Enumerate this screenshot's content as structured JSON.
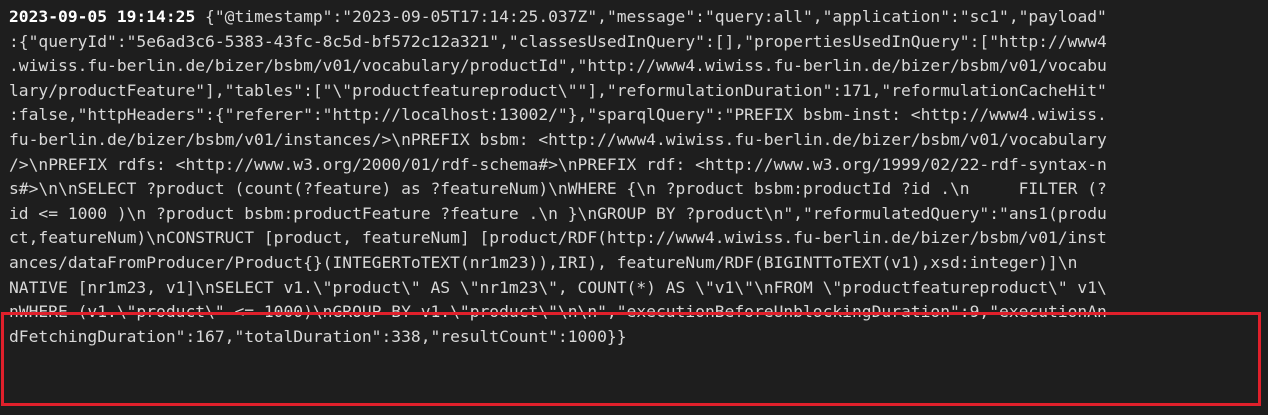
{
  "terminal": {
    "timestamp": "2023-09-05 19:14:25",
    "first_line_rest": " {\"@timestamp\":\"2023-09-05T17:14:25.037Z\",\"message\":\"query:all\",\"application\":\"sc1\",\"payload\"",
    "lines": [
      ":{\"queryId\":\"5e6ad3c6-5383-43fc-8c5d-bf572c12a321\",\"classesUsedInQuery\":[],\"propertiesUsedInQuery\":[\"http://www4",
      ".wiwiss.fu-berlin.de/bizer/bsbm/v01/vocabulary/productId\",\"http://www4.wiwiss.fu-berlin.de/bizer/bsbm/v01/vocabu",
      "lary/productFeature\"],\"tables\":[\"\\\"productfeatureproduct\\\"\"],\"reformulationDuration\":171,\"reformulationCacheHit\"",
      ":false,\"httpHeaders\":{\"referer\":\"http://localhost:13002/\"},\"sparqlQuery\":\"PREFIX bsbm-inst: <http://www4.wiwiss.",
      "fu-berlin.de/bizer/bsbm/v01/instances/>\\nPREFIX bsbm: <http://www4.wiwiss.fu-berlin.de/bizer/bsbm/v01/vocabulary",
      "/>\\nPREFIX rdfs: <http://www.w3.org/2000/01/rdf-schema#>\\nPREFIX rdf: <http://www.w3.org/1999/02/22-rdf-syntax-n",
      "s#>\\n\\nSELECT ?product (count(?feature) as ?featureNum)\\nWHERE {\\n ?product bsbm:productId ?id .\\n     FILTER (?",
      "id <= 1000 )\\n ?product bsbm:productFeature ?feature .\\n }\\nGROUP BY ?product\\n\",\"reformulatedQuery\":\"ans1(produ",
      "ct,featureNum)\\nCONSTRUCT [product, featureNum] [product/RDF(http://www4.wiwiss.fu-berlin.de/bizer/bsbm/v01/inst",
      "ances/dataFromProducer/Product{}(INTEGERToTEXT(nr1m23)),IRI), featureNum/RDF(BIGINTToTEXT(v1),xsd:integer)]\\n",
      "NATIVE [nr1m23, v1]\\nSELECT v1.\\\"product\\\" AS \\\"nr1m23\\\", COUNT(*) AS \\\"v1\\\"\\nFROM \\\"productfeatureproduct\\\" v1\\",
      "nWHERE (v1.\\\"product\\\" <= 1000)\\nGROUP BY v1.\\\"product\\\"\\n\\n\",\"executionBeforeUnblockingDuration\":9,\"executionAn",
      "dFetchingDuration\":167,\"totalDuration\":338,\"resultCount\":1000}}"
    ]
  },
  "highlight": {
    "color": "#e0202b"
  }
}
